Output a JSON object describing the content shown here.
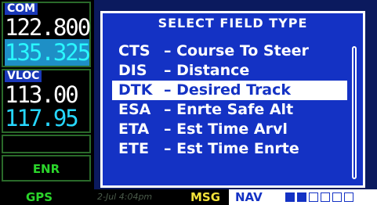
{
  "com": {
    "tag": "COM",
    "active": "122.800",
    "standby": "135.325"
  },
  "vloc": {
    "tag": "VLOC",
    "active": "113.00",
    "standby": "117.95"
  },
  "mode": "ENR",
  "popup": {
    "title": "SELECT FIELD TYPE",
    "items": [
      {
        "code": "CTS",
        "label": "– Course To Steer",
        "selected": false
      },
      {
        "code": "DIS",
        "label": "– Distance",
        "selected": false
      },
      {
        "code": "DTK",
        "label": "– Desired Track",
        "selected": true
      },
      {
        "code": "ESA",
        "label": "– Enrte Safe Alt",
        "selected": false
      },
      {
        "code": "ETA",
        "label": "– Est Time Arvl",
        "selected": false
      },
      {
        "code": "ETE",
        "label": "– Est Time Enrte",
        "selected": false
      }
    ]
  },
  "bottom": {
    "gps": "GPS",
    "mid_text": "2-Jul 4:04pm",
    "msg": "MSG",
    "nav": "NAV"
  },
  "colors": {
    "popup_bg": "#1432c4",
    "standby": "#27d7ff",
    "mode_green": "#2bd52b",
    "msg_yellow": "#f3e23a"
  }
}
